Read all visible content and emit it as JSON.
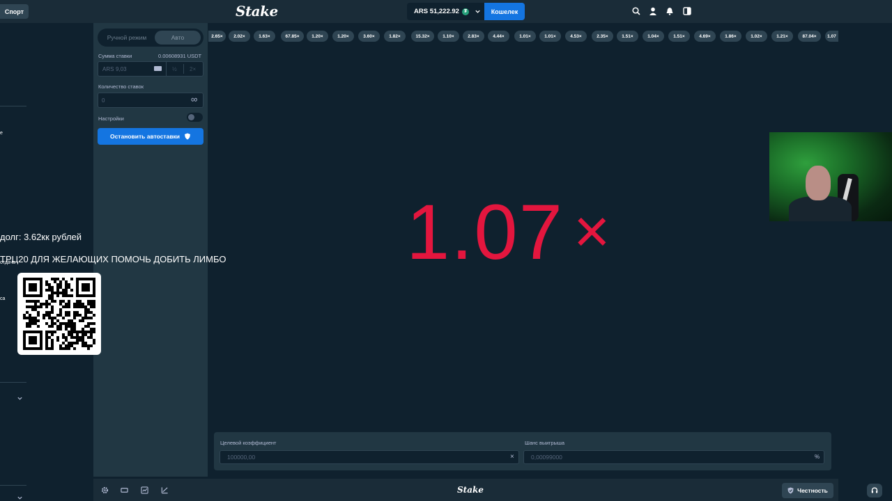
{
  "topbar": {
    "sport_label": "Спорт",
    "logo": "Stake",
    "balance": "ARS 51,222.92",
    "currency_icon": "tether-icon",
    "wallet_label": "Кошелек"
  },
  "panel": {
    "mode_manual": "Ручной режим",
    "mode_auto": "Авто",
    "bet_amount_label": "Сумма ставки",
    "bet_amount_usdt": "0.00608931 USDT",
    "bet_currency": "ARS",
    "bet_value": "9,03",
    "half_label": "½",
    "double_label": "2×",
    "bet_count_label": "Количество ставок",
    "bet_count_value": "0",
    "infinity": "∞",
    "settings_label": "Настройки",
    "stop_label": "Остановить автоставки"
  },
  "history": [
    "2.65×",
    "2.02×",
    "1.63×",
    "67.85×",
    "1.20×",
    "1.20×",
    "3.60×",
    "1.82×",
    "15.32×",
    "1.10×",
    "2.83×",
    "4.44×",
    "1.01×",
    "1.01×",
    "4.53×",
    "2.35×",
    "1.51×",
    "1.04×",
    "1.51×",
    "4.69×",
    "1.86×",
    "1.02×",
    "1.21×",
    "87.04×",
    "1.07"
  ],
  "game": {
    "result": "1.07",
    "result_suffix": "×",
    "result_color": "#e3163e",
    "target_label": "Целевой коэффициент",
    "target_value": "100000,00",
    "target_clear": "×",
    "chance_label": "Шанс выигрыша",
    "chance_value": "0,00099000",
    "chance_suffix": "%"
  },
  "footer": {
    "logo": "Stake",
    "fairness_label": "Честность"
  },
  "overlay": {
    "debt_text": "долг: 3.62кк рублей",
    "call_text": "ТРЦ20 ДЛЯ ЖЕЛАЮЩИХ ПОМОЧЬ ДОБИТЬ ЛИМБО"
  },
  "sidebar": {
    "frag1": "е",
    "frag2": "отдача",
    "frag3": "са"
  },
  "colors": {
    "accent": "#1475e1",
    "bg": "#0f212e",
    "panel": "#213743",
    "pill": "#2f4553"
  }
}
